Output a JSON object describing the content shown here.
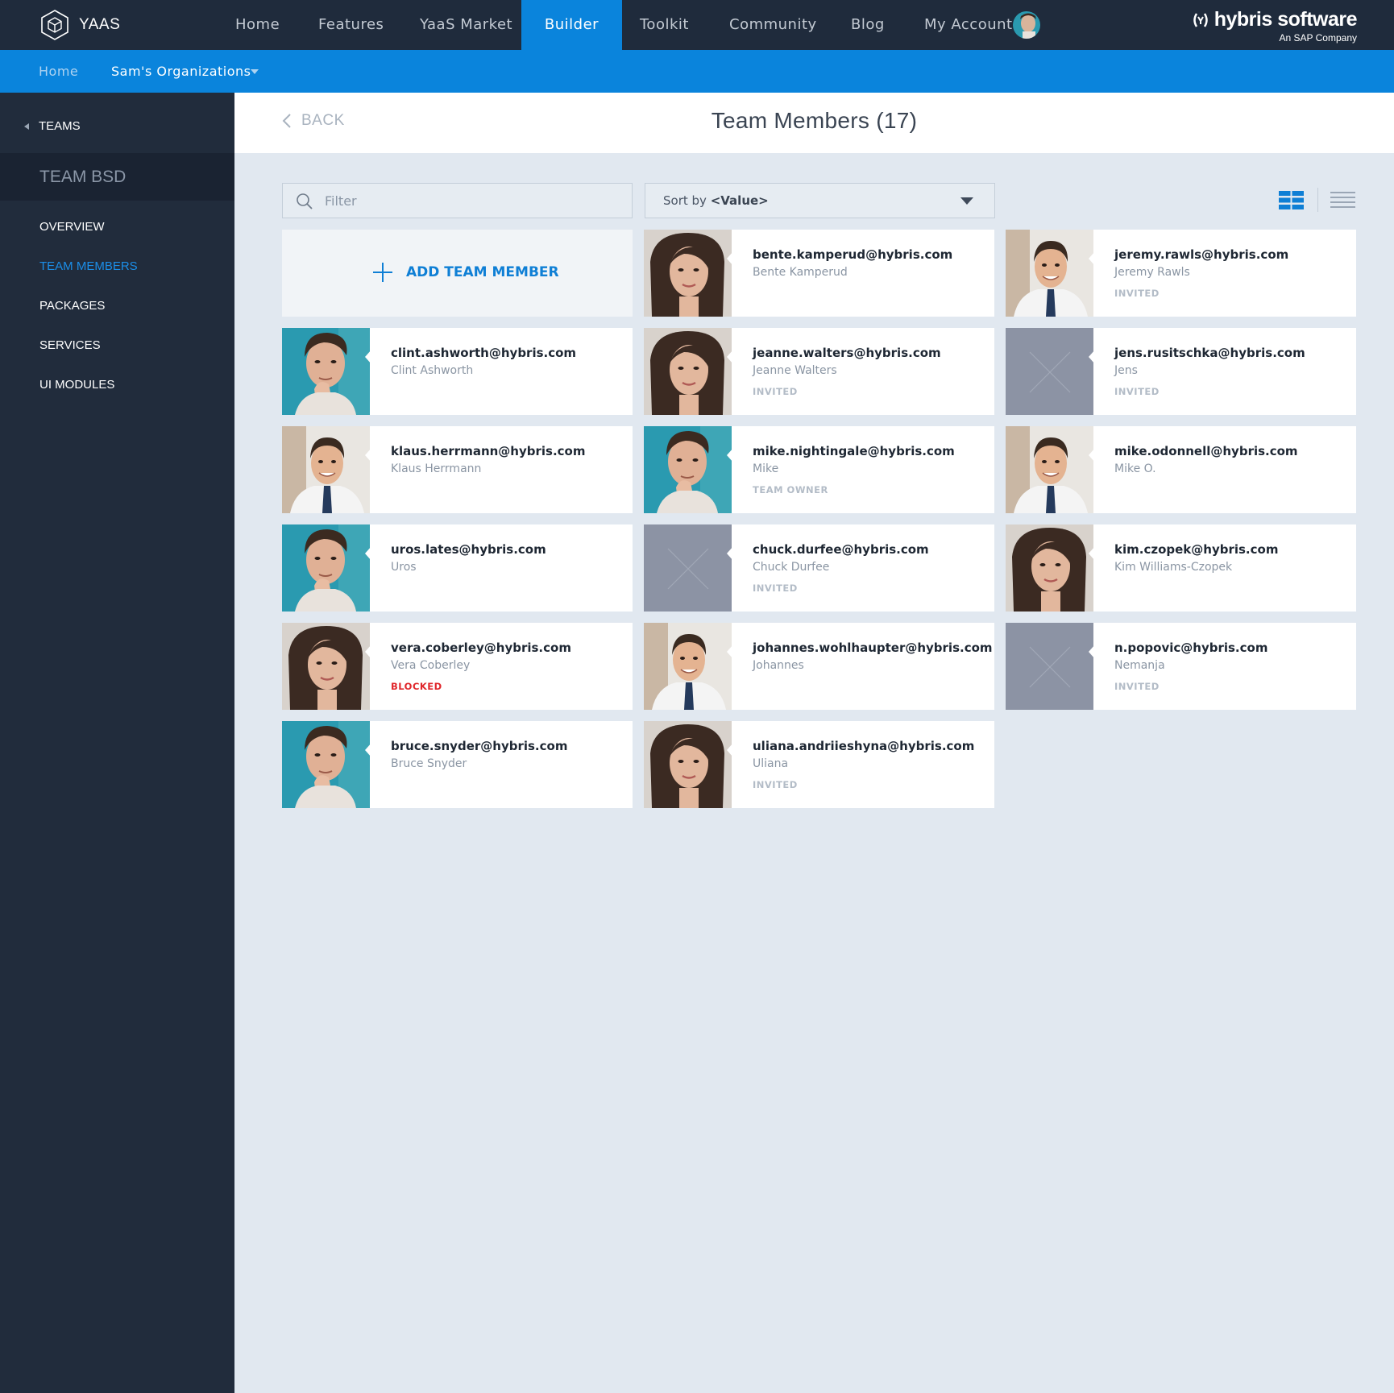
{
  "topnav": {
    "logo_text": "YAAS",
    "items": [
      "Home",
      "Features",
      "YaaS Market",
      "Builder",
      "Toolkit",
      "Community",
      "Blog",
      "My Account"
    ],
    "active": "Builder",
    "brand_name": "hybris software",
    "brand_sub": "An SAP Company"
  },
  "subnav": {
    "home": "Home",
    "org": "Sam's Organizations"
  },
  "sidebar": {
    "back": "TEAMS",
    "team": "TEAM BSD",
    "items": [
      "OVERVIEW",
      "TEAM MEMBERS",
      "PACKAGES",
      "SERVICES",
      "UI MODULES"
    ],
    "active": "TEAM MEMBERS"
  },
  "header": {
    "back": "BACK",
    "title": "Team Members (17)"
  },
  "toolbar": {
    "filter_placeholder": "Filter",
    "sort_prefix": "Sort by",
    "sort_value": "<Value>"
  },
  "add_member": "ADD TEAM MEMBER",
  "colors": {
    "accent": "#0a84dc",
    "nav_bg": "#1f2b3c",
    "blocked": "#e0262b"
  },
  "members": [
    {
      "email": "bente.kamperud@hybris.com",
      "name": "Bente Kamperud",
      "status": "",
      "photo": "woman"
    },
    {
      "email": "jeremy.rawls@hybris.com",
      "name": "Jeremy Rawls",
      "status": "INVITED",
      "photo": "man-suit"
    },
    {
      "email": "clint.ashworth@hybris.com",
      "name": "Clint Ashworth",
      "status": "",
      "photo": "man-young"
    },
    {
      "email": "jeanne.walters@hybris.com",
      "name": "Jeanne Walters",
      "status": "INVITED",
      "photo": "woman"
    },
    {
      "email": "jens.rusitschka@hybris.com",
      "name": "Jens",
      "status": "INVITED",
      "photo": "placeholder"
    },
    {
      "email": "klaus.herrmann@hybris.com",
      "name": "Klaus Herrmann",
      "status": "",
      "photo": "man-suit"
    },
    {
      "email": "mike.nightingale@hybris.com",
      "name": "Mike",
      "status": "TEAM OWNER",
      "photo": "man-young"
    },
    {
      "email": "mike.odonnell@hybris.com",
      "name": "Mike O.",
      "status": "",
      "photo": "man-suit"
    },
    {
      "email": "uros.lates@hybris.com",
      "name": "Uros",
      "status": "",
      "photo": "man-young"
    },
    {
      "email": "chuck.durfee@hybris.com",
      "name": "Chuck Durfee",
      "status": "INVITED",
      "photo": "placeholder"
    },
    {
      "email": "kim.czopek@hybris.com",
      "name": "Kim Williams-Czopek",
      "status": "",
      "photo": "woman"
    },
    {
      "email": "vera.coberley@hybris.com",
      "name": "Vera Coberley",
      "status": "BLOCKED",
      "photo": "woman"
    },
    {
      "email": "johannes.wohlhaupter@hybris.com",
      "name": "Johannes",
      "status": "",
      "photo": "man-suit"
    },
    {
      "email": "n.popovic@hybris.com",
      "name": "Nemanja",
      "status": "INVITED",
      "photo": "placeholder"
    },
    {
      "email": "bruce.snyder@hybris.com",
      "name": "Bruce Snyder",
      "status": "",
      "photo": "man-young"
    },
    {
      "email": "uliana.andriieshyna@hybris.com",
      "name": "Uliana",
      "status": "INVITED",
      "photo": "woman"
    }
  ]
}
